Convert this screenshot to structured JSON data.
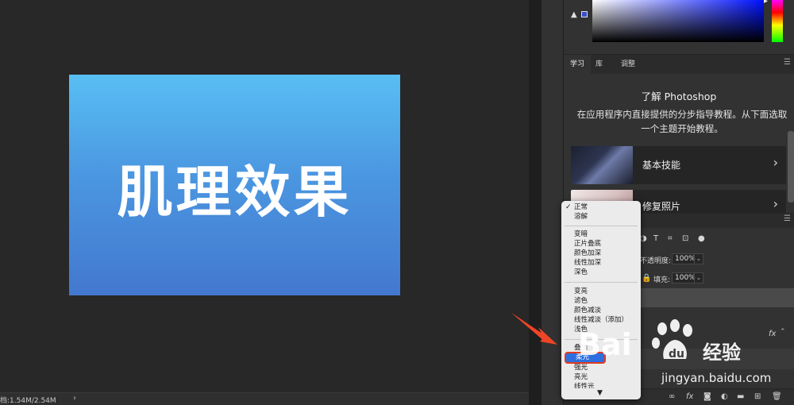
{
  "canvas": {
    "text": "肌理效果",
    "gradient_top": "#58bff3",
    "gradient_bottom": "#4378cf"
  },
  "status_bar": {
    "text": "档:1.54M/2.54M",
    "arrow": "›"
  },
  "learn_panel": {
    "tabs": [
      "学习",
      "库",
      "调整"
    ],
    "title": "了解 Photoshop",
    "description": "在应用程序内直接提供的分步指导教程。从下面选取一个主题开始教程。",
    "tutorials": [
      {
        "label": "基本技能"
      },
      {
        "label": "修复照片"
      }
    ]
  },
  "layers_panel": {
    "opacity_label": "不透明度:",
    "opacity_value": "100%",
    "fill_label": "填充:",
    "fill_value": "100%",
    "fx_badge": "fx"
  },
  "blend_menu": {
    "items": [
      {
        "label": "正常",
        "group": 1,
        "checked": true
      },
      {
        "label": "溶解",
        "group": 1
      },
      {
        "label": "变暗",
        "group": 2
      },
      {
        "label": "正片叠底",
        "group": 2
      },
      {
        "label": "颜色加深",
        "group": 2
      },
      {
        "label": "线性加深",
        "group": 2
      },
      {
        "label": "深色",
        "group": 2
      },
      {
        "label": "变亮",
        "group": 3
      },
      {
        "label": "滤色",
        "group": 3
      },
      {
        "label": "颜色减淡",
        "group": 3
      },
      {
        "label": "线性减淡（添加）",
        "group": 3
      },
      {
        "label": "浅色",
        "group": 3
      },
      {
        "label": "叠加",
        "group": 4
      },
      {
        "label": "柔光",
        "group": 4,
        "selected": true
      },
      {
        "label": "强光",
        "group": 4
      },
      {
        "label": "亮光",
        "group": 4
      },
      {
        "label": "线性光",
        "group": 4
      }
    ],
    "highlight_color": "#2d6fe0",
    "outline_color": "#e23b1f"
  },
  "watermark": {
    "logo": "Bai",
    "logo_suffix": "du",
    "cn": "经验",
    "url": "jingyan.baidu.com"
  },
  "icons": [
    "warning-icon",
    "chevron-right-icon",
    "lock-icon",
    "type-icon",
    "fx-icon",
    "trash-icon",
    "folder-icon",
    "new-layer-icon",
    "mask-icon",
    "link-icon"
  ]
}
